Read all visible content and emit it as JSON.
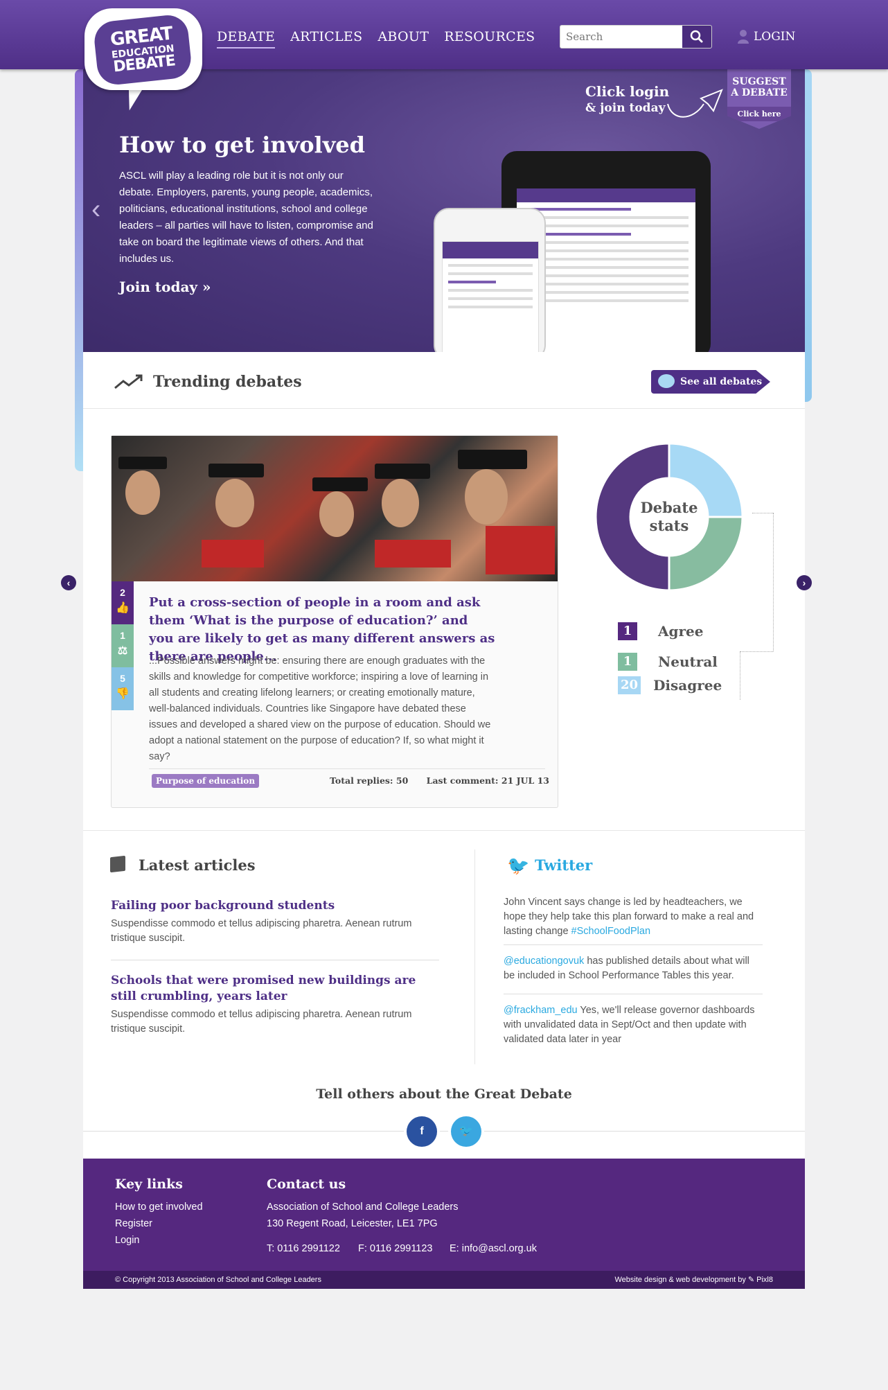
{
  "header": {
    "logo": {
      "line1": "GREAT",
      "line2": "EDUCATION",
      "line3": "DEBATE"
    },
    "nav": [
      "DEBATE",
      "ARTICLES",
      "ABOUT",
      "RESOURCES"
    ],
    "search_placeholder": "Search",
    "login_label": "LOGIN"
  },
  "hero": {
    "title": "How to get involved",
    "text": "ASCL will play a leading role but it is not only our debate. Employers, parents, young people, academics, politicians, educational institutions, school and college leaders – all parties will have to listen, compromise and take on board the legitimate views of others. And that includes us.",
    "cta": "Join today »",
    "click_login_1": "Click login",
    "click_login_2": "& join today",
    "suggest_1": "SUGGEST",
    "suggest_2": "A DEBATE",
    "suggest_cta": "Click here"
  },
  "trending": {
    "title": "Trending debates",
    "see_all": "See all debates",
    "votes": [
      {
        "count": "2",
        "icon": "thumbs-up-icon",
        "color": "#55287f"
      },
      {
        "count": "1",
        "icon": "scales-icon",
        "color": "#7fbd9f"
      },
      {
        "count": "5",
        "icon": "thumbs-down-icon",
        "color": "#86c2e6"
      }
    ],
    "question": "Put a cross-section of people in a room and ask them ‘What is the purpose of education?’ and you are likely to get as many different answers as there are people...",
    "body": "...Possible answers might be: ensuring there are enough graduates with the skills and knowledge for competitive workforce; inspiring a love of learning in all students and creating lifelong learners; or creating emotionally mature, well-balanced individuals. Countries like Singapore have debated these issues and developed a shared view on the purpose of education. Should we adopt a national statement on the purpose of education? If, so what might it say?",
    "tag": "Purpose of education",
    "total_replies": "Total replies: 50",
    "last_comment": "Last comment: 21 JUL 13",
    "stats_label_1": "Debate",
    "stats_label_2": "stats",
    "stats": [
      {
        "count": "1",
        "label": "Agree",
        "color": "#55287f"
      },
      {
        "count": "1",
        "label": "Neutral",
        "color": "#7fbd9f"
      },
      {
        "count": "20",
        "label": "Disagree",
        "color": "#a7d7f4"
      }
    ]
  },
  "chart_data": {
    "type": "pie",
    "title": "Debate stats",
    "slices": [
      {
        "label": "Agree",
        "value": 50,
        "color": "#55387f"
      },
      {
        "label": "Disagree",
        "value": 25,
        "color": "#a7d9f5"
      },
      {
        "label": "Neutral",
        "value": 25,
        "color": "#87bca0"
      }
    ]
  },
  "latest": {
    "title": "Latest articles",
    "articles": [
      {
        "title": "Failing poor background students",
        "text": "Suspendisse commodo et tellus adipiscing pharetra. Aenean rutrum tristique suscipit."
      },
      {
        "title": "Schools that were promised new buildings are still crumbling, years later",
        "text": "Suspendisse commodo et tellus adipiscing pharetra. Aenean rutrum tristique suscipit."
      }
    ]
  },
  "twitter": {
    "title": "Twitter",
    "tweets": [
      {
        "handle": "",
        "text": "John Vincent says change is led by headteachers, we hope they help take this plan forward to make a real and lasting change ",
        "hashtag": "#SchoolFoodPlan"
      },
      {
        "handle": "@educationgovuk",
        "text": " has published details about what will be included in School Performance Tables this year.",
        "hashtag": ""
      },
      {
        "handle": "@frackham_edu",
        "text": " Yes, we'll release governor dashboards with unvalidated data in Sept/Oct and then update with validated data later in year",
        "hashtag": ""
      }
    ]
  },
  "share": {
    "title": "Tell others about the Great Debate",
    "facebook": "f",
    "twitter": "t"
  },
  "footer": {
    "key_links_title": "Key links",
    "links": [
      "How to get involved",
      "Register",
      "Login"
    ],
    "contact_title": "Contact us",
    "org": "Association of School and College Leaders",
    "address": "130 Regent Road, Leicester, LE1 7PG",
    "phone": "T: 0116 2991122",
    "fax": "F: 0116 2991123",
    "email": "E: info@ascl.org.uk",
    "copyright": "© Copyright 2013 Association of School and College Leaders",
    "credit": "Website design & web development by ✎ Pixl8"
  }
}
